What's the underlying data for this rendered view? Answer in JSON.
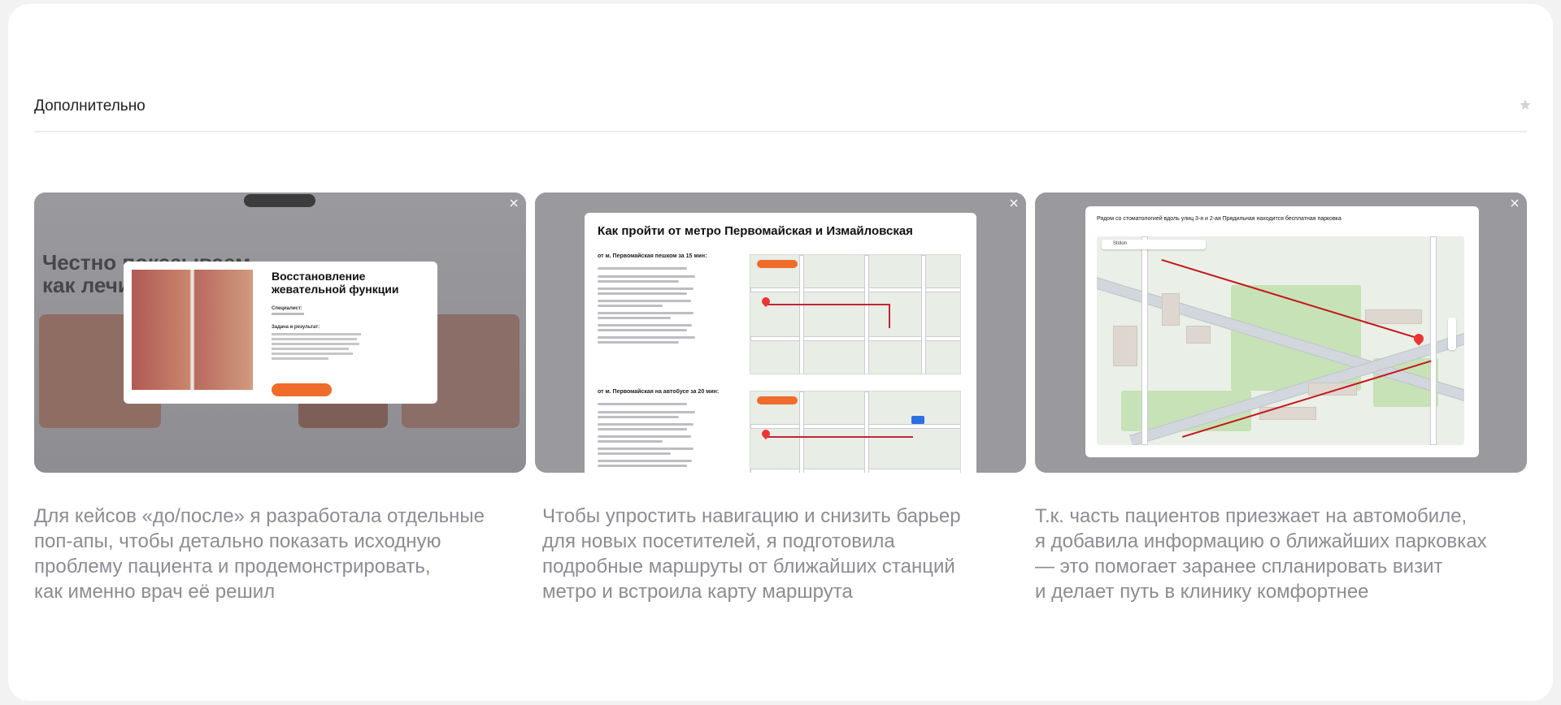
{
  "section": {
    "title": "Дополнительно",
    "star_icon": "star-icon"
  },
  "shots": [
    {
      "background_title": "Честно показываем\nкак лечим",
      "modal": {
        "title": "Восстановление\nжевательной функции",
        "specialist_label": "Специалист:",
        "result_label": "Задача и результат:"
      },
      "caption": "Для кейсов «до/после» я разработала отдельные\nпоп-апы, чтобы детально показать исходную\nпроблему пациента и продемонстрировать,\nкак именно врач её решил"
    },
    {
      "modal": {
        "title": "Как пройти от метро Первомайская и Измайловская",
        "route1": "от м. Первомайская пешком за 15 мин:",
        "route2": "от м. Первомайская на автобусе за 20 мин:"
      },
      "caption": "Чтобы упростить навигацию и снизить барьер\nдля новых посетителей, я подготовила\nподробные маршруты от ближайших станций\nметро и встроила карту маршрута"
    },
    {
      "modal": {
        "title": "Рядом со стоматологией вдоль улиц 3-я и 2-ая Прядильная находится бесплатная парковка",
        "map_search": "Stolon"
      },
      "caption": "Т.к. часть пациентов приезжает на автомобиле,\nя добавила информацию о ближайших парковках\n— это помогает заранее спланировать визит\nи делает путь в клинику комфортнее"
    }
  ],
  "colors": {
    "accent_orange": "#ef6c2b",
    "route_red": "#c3243a",
    "caption_gray": "#8c8c92"
  }
}
